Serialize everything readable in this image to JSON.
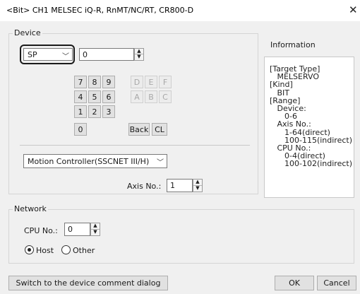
{
  "window": {
    "title": "<Bit> CH1 MELSEC iQ-R, RnMT/NC/RT, CR800-D",
    "close_glyph": "✕"
  },
  "device": {
    "group_label": "Device",
    "device_type_value": "SP",
    "device_number_value": "0",
    "keypad": [
      {
        "label": "7",
        "enabled": true
      },
      {
        "label": "8",
        "enabled": true
      },
      {
        "label": "9",
        "enabled": true
      },
      {
        "label": "D",
        "enabled": false
      },
      {
        "label": "E",
        "enabled": false
      },
      {
        "label": "F",
        "enabled": false
      },
      {
        "label": "4",
        "enabled": true
      },
      {
        "label": "5",
        "enabled": true
      },
      {
        "label": "6",
        "enabled": true
      },
      {
        "label": "A",
        "enabled": false
      },
      {
        "label": "B",
        "enabled": false
      },
      {
        "label": "C",
        "enabled": false
      },
      {
        "label": "1",
        "enabled": true
      },
      {
        "label": "2",
        "enabled": true
      },
      {
        "label": "3",
        "enabled": true
      },
      {
        "label": "0",
        "enabled": true
      },
      {
        "label": "Back",
        "enabled": true
      },
      {
        "label": "CL",
        "enabled": true
      }
    ],
    "controller_type_value": "Motion Controller(SSCNET III/H)",
    "axis_label": "Axis No.:",
    "axis_value": "1"
  },
  "information": {
    "title": "Information",
    "lines": [
      "[Target Type]",
      "   MELSERVO",
      "[Kind]",
      "   BIT",
      "[Range]",
      "   Device:",
      "      0-6",
      "   Axis No.:",
      "      1-64(direct)",
      "      100-115(indirect)",
      "   CPU No.:",
      "      0-4(direct)",
      "      100-102(indirect)"
    ]
  },
  "network": {
    "group_label": "Network",
    "cpu_label": "CPU No.:",
    "cpu_value": "0",
    "host_label": "Host",
    "other_label": "Other",
    "selected": "Host"
  },
  "footer": {
    "switch_label": "Switch to the device comment dialog",
    "ok_label": "OK",
    "cancel_label": "Cancel"
  },
  "colors": {
    "highlight_outline": "#1a1a1a",
    "dialog_bg": "#f0f0f0",
    "disabled_text": "#a8a8a8"
  }
}
